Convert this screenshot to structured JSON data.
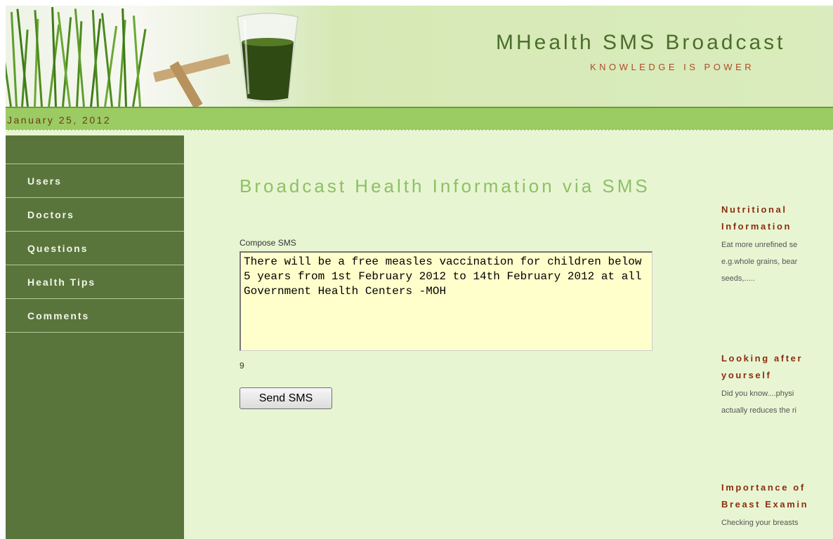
{
  "header": {
    "site_title": "MHealth SMS Broadcast",
    "tagline": "KNOWLEDGE IS POWER"
  },
  "date_bar": {
    "date": "January 25, 2012"
  },
  "sidebar": {
    "items": [
      {
        "label": "Users"
      },
      {
        "label": "Doctors"
      },
      {
        "label": "Questions"
      },
      {
        "label": "Health Tips"
      },
      {
        "label": "Comments"
      }
    ]
  },
  "main": {
    "heading": "Broadcast Health Information via SMS",
    "compose_label": "Compose SMS",
    "sms_text": "There will be a free measles vaccination for children below 5 years from 1st February 2012 to 14th February 2012 at all Government Health Centers -MOH",
    "char_count": "9",
    "send_label": "Send SMS"
  },
  "tips": [
    {
      "title": "Nutritional Information",
      "body": "Eat more unrefined se\ne.g.whole grains, bear\nseeds,....."
    },
    {
      "title": "Looking after yourself",
      "body": "  Did you know....physi\nactually reduces the ri"
    },
    {
      "title": "Importance of Breast Examin",
      "body": "Checking your breasts"
    }
  ],
  "colors": {
    "sidebar": "#5a753c",
    "date_bar": "#9bcb63",
    "heading": "#8cc166",
    "tip_title": "#8b2d10",
    "textarea_bg": "#ffffcc"
  }
}
